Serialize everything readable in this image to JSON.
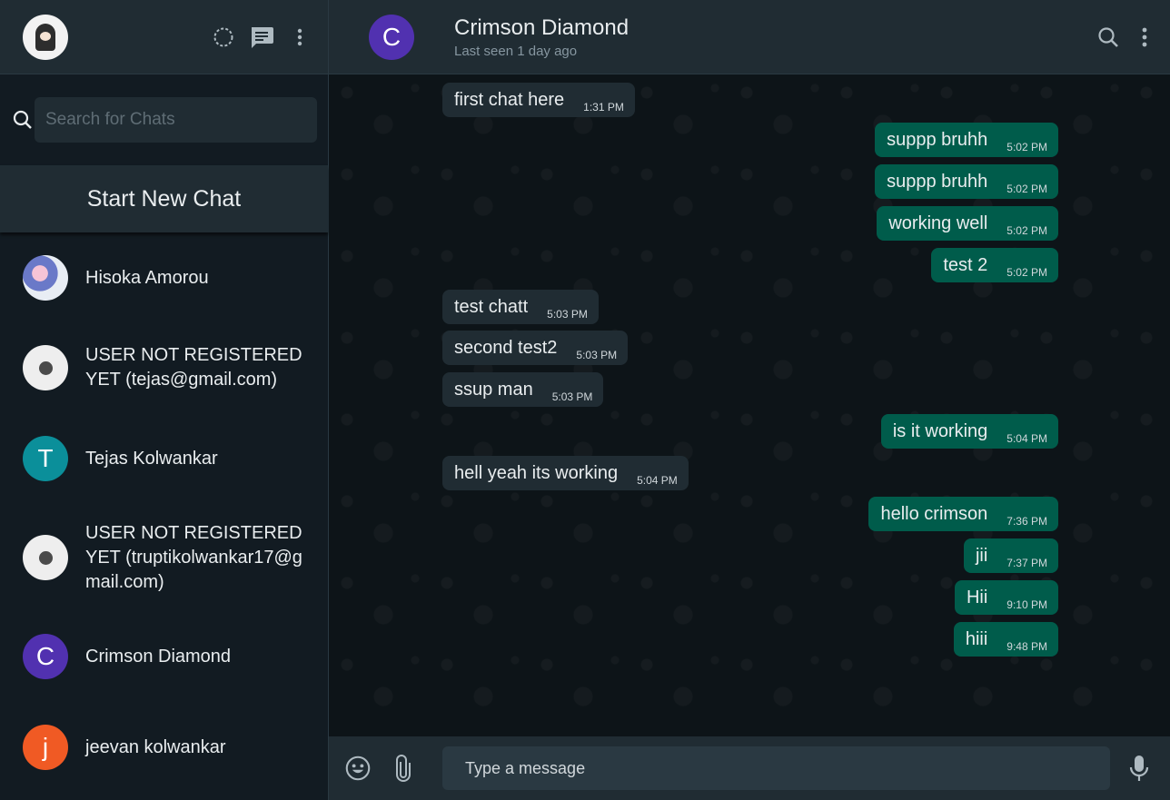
{
  "sidebar": {
    "search_placeholder": "Search for Chats",
    "new_chat_label": "Start New Chat",
    "chats": [
      {
        "name": "Hisoka Amorou",
        "avatar": "photo"
      },
      {
        "name": "USER NOT REGISTERED YET (tejas@gmail.com)",
        "avatar": "not-found"
      },
      {
        "name": "Tejas Kolwankar",
        "avatar": "T",
        "color": "#0b8f9a"
      },
      {
        "name": "USER NOT REGISTERED YET (truptikolwankar17@gmail.com)",
        "avatar": "not-found"
      },
      {
        "name": "Crimson Diamond",
        "avatar": "C",
        "color": "#5131b0"
      },
      {
        "name": "jeevan kolwankar",
        "avatar": "j",
        "color": "#f05a24"
      }
    ]
  },
  "chat": {
    "name": "Crimson Diamond",
    "avatar_letter": "C",
    "last_seen": "Last seen 1 day ago",
    "messages": [
      {
        "text": "first chat here",
        "time": "1:31 PM",
        "dir": "in"
      },
      {
        "text": "suppp bruhh",
        "time": "5:02 PM",
        "dir": "out"
      },
      {
        "text": "suppp bruhh",
        "time": "5:02 PM",
        "dir": "out"
      },
      {
        "text": "working well",
        "time": "5:02 PM",
        "dir": "out"
      },
      {
        "text": "test 2",
        "time": "5:02 PM",
        "dir": "out"
      },
      {
        "text": "test chatt",
        "time": "5:03 PM",
        "dir": "in"
      },
      {
        "text": "second test2",
        "time": "5:03 PM",
        "dir": "in"
      },
      {
        "text": "ssup man",
        "time": "5:03 PM",
        "dir": "in"
      },
      {
        "text": "is it working",
        "time": "5:04 PM",
        "dir": "out"
      },
      {
        "text": "hell yeah its working",
        "time": "5:04 PM",
        "dir": "in"
      },
      {
        "text": "hello crimson",
        "time": "7:36 PM",
        "dir": "out"
      },
      {
        "text": "jii",
        "time": "7:37 PM",
        "dir": "out"
      },
      {
        "text": "Hii",
        "time": "9:10 PM",
        "dir": "out"
      },
      {
        "text": "hiii",
        "time": "9:48 PM",
        "dir": "out"
      }
    ],
    "input_placeholder": "Type a message"
  },
  "colors": {
    "outgoing_bubble": "#005c4b",
    "incoming_bubble": "#202c33",
    "panel": "#202c33",
    "background": "#0d1418"
  },
  "icons": [
    "status-icon",
    "new-chat-icon",
    "menu-dots-icon",
    "search-icon",
    "emoji-icon",
    "attach-icon",
    "mic-icon"
  ]
}
